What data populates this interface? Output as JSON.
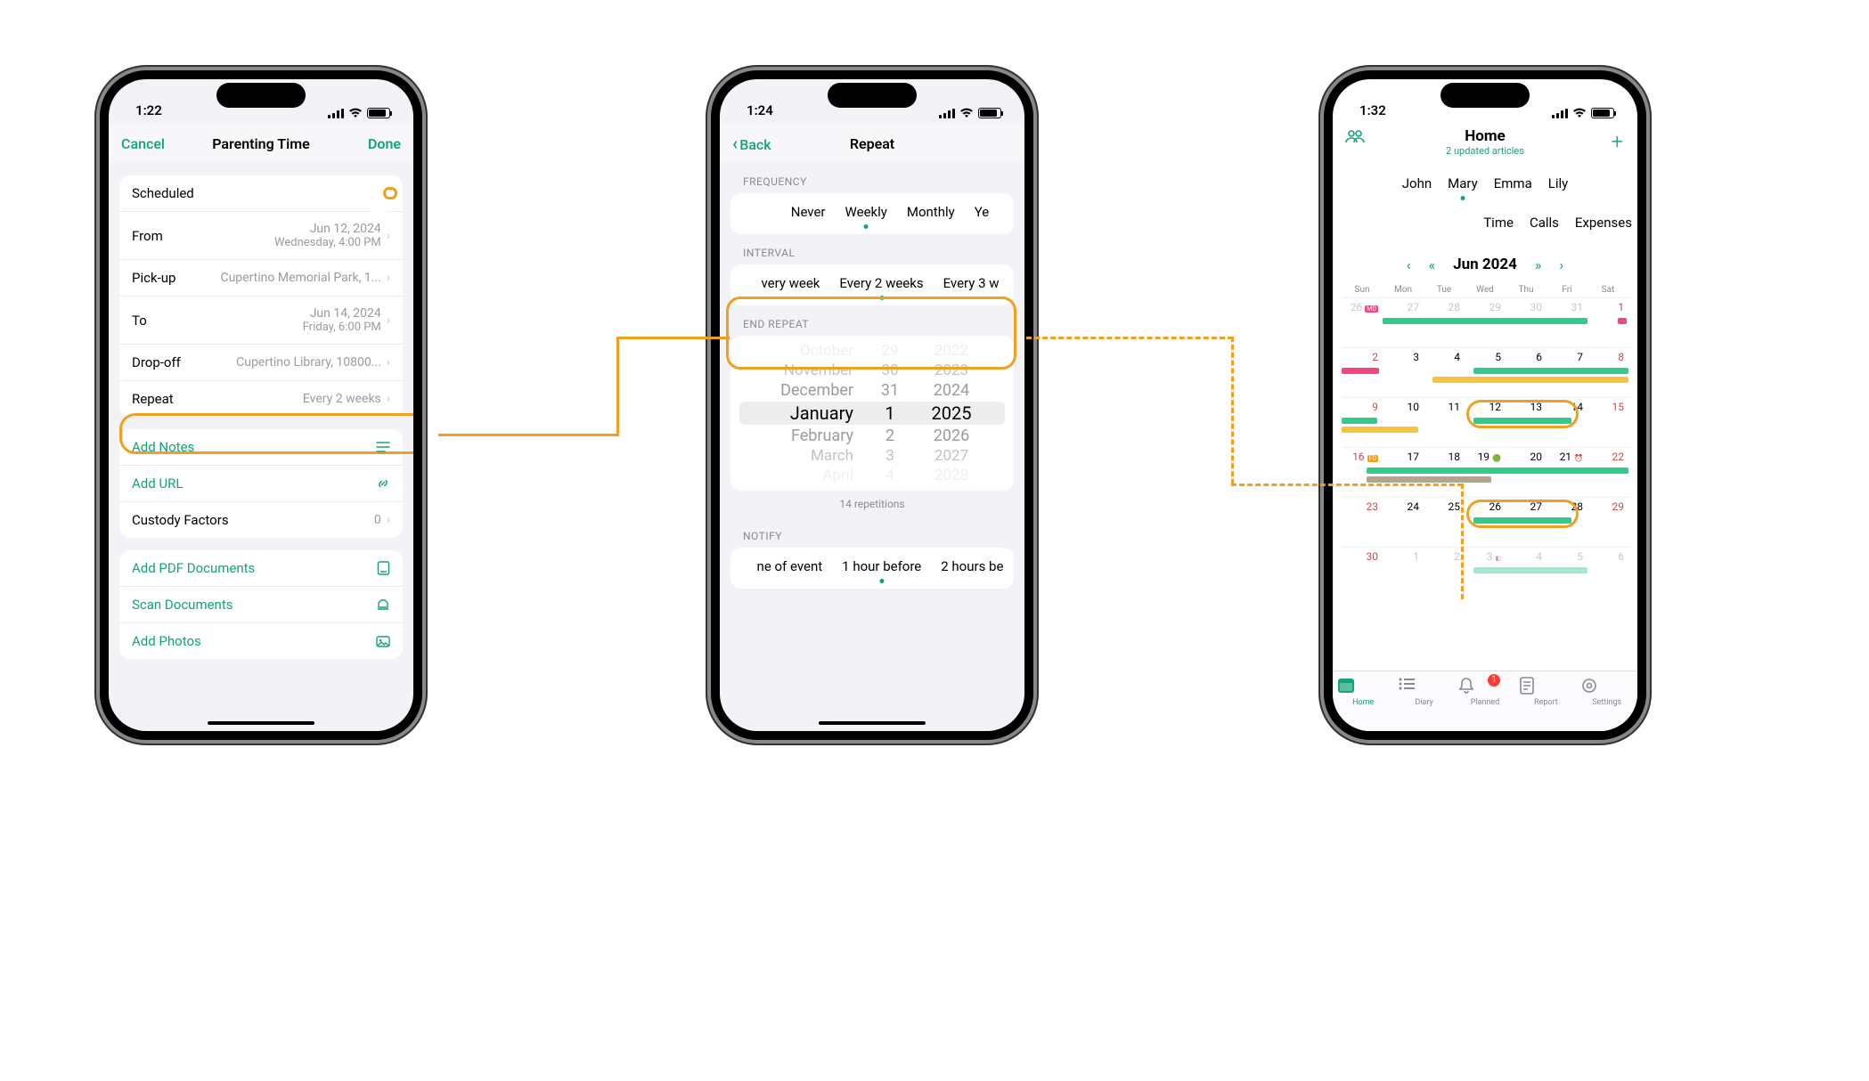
{
  "phone1": {
    "time": "1:22",
    "nav": {
      "cancel": "Cancel",
      "title": "Parenting Time",
      "done": "Done"
    },
    "rows": {
      "scheduled_label": "Scheduled",
      "from_label": "From",
      "from_date": "Jun 12, 2024",
      "from_time": "Wednesday, 4:00 PM",
      "pickup_label": "Pick-up",
      "pickup_val": "Cupertino Memorial Park, 1...",
      "to_label": "To",
      "to_date": "Jun 14, 2024",
      "to_time": "Friday, 6:00 PM",
      "dropoff_label": "Drop-off",
      "dropoff_val": "Cupertino Library, 10800...",
      "repeat_label": "Repeat",
      "repeat_val": "Every 2 weeks"
    },
    "actions": {
      "notes": "Add Notes",
      "url": "Add URL",
      "custody": "Custody Factors",
      "custody_val": "0",
      "pdf": "Add PDF Documents",
      "scan": "Scan Documents",
      "photos": "Add Photos"
    }
  },
  "phone2": {
    "time": "1:24",
    "nav": {
      "back": "Back",
      "title": "Repeat"
    },
    "freq_label": "FREQUENCY",
    "freq_opts": [
      "Never",
      "Weekly",
      "Monthly",
      "Ye"
    ],
    "interval_label": "INTERVAL",
    "interval_opts": [
      "very week",
      "Every 2 weeks",
      "Every 3 w"
    ],
    "end_label": "END REPEAT",
    "picker": {
      "r0": {
        "m": "October",
        "d": "29",
        "y": "2022"
      },
      "r1": {
        "m": "November",
        "d": "30",
        "y": "2023"
      },
      "r2": {
        "m": "December",
        "d": "31",
        "y": "2024"
      },
      "sel": {
        "m": "January",
        "d": "1",
        "y": "2025"
      },
      "r4": {
        "m": "February",
        "d": "2",
        "y": "2026"
      },
      "r5": {
        "m": "March",
        "d": "3",
        "y": "2027"
      },
      "r6": {
        "m": "April",
        "d": "4",
        "y": "2028"
      }
    },
    "rep_count": "14 repetitions",
    "notify_label": "NOTIFY",
    "notify_opts": [
      "ne of event",
      "1 hour before",
      "2 hours be"
    ]
  },
  "phone3": {
    "time": "1:32",
    "header": {
      "title": "Home",
      "sub": "2 updated articles"
    },
    "people": [
      "John",
      "Mary",
      "Emma",
      "Lily"
    ],
    "subtabs": [
      "Time",
      "Calls",
      "Expenses"
    ],
    "month": "Jun 2024",
    "days": [
      "Sun",
      "Mon",
      "Tue",
      "Wed",
      "Thu",
      "Fri",
      "Sat"
    ],
    "tabs": {
      "home": "Home",
      "diary": "Diary",
      "planned": "Planned",
      "report": "Report",
      "settings": "Settings",
      "badge": "1"
    }
  }
}
